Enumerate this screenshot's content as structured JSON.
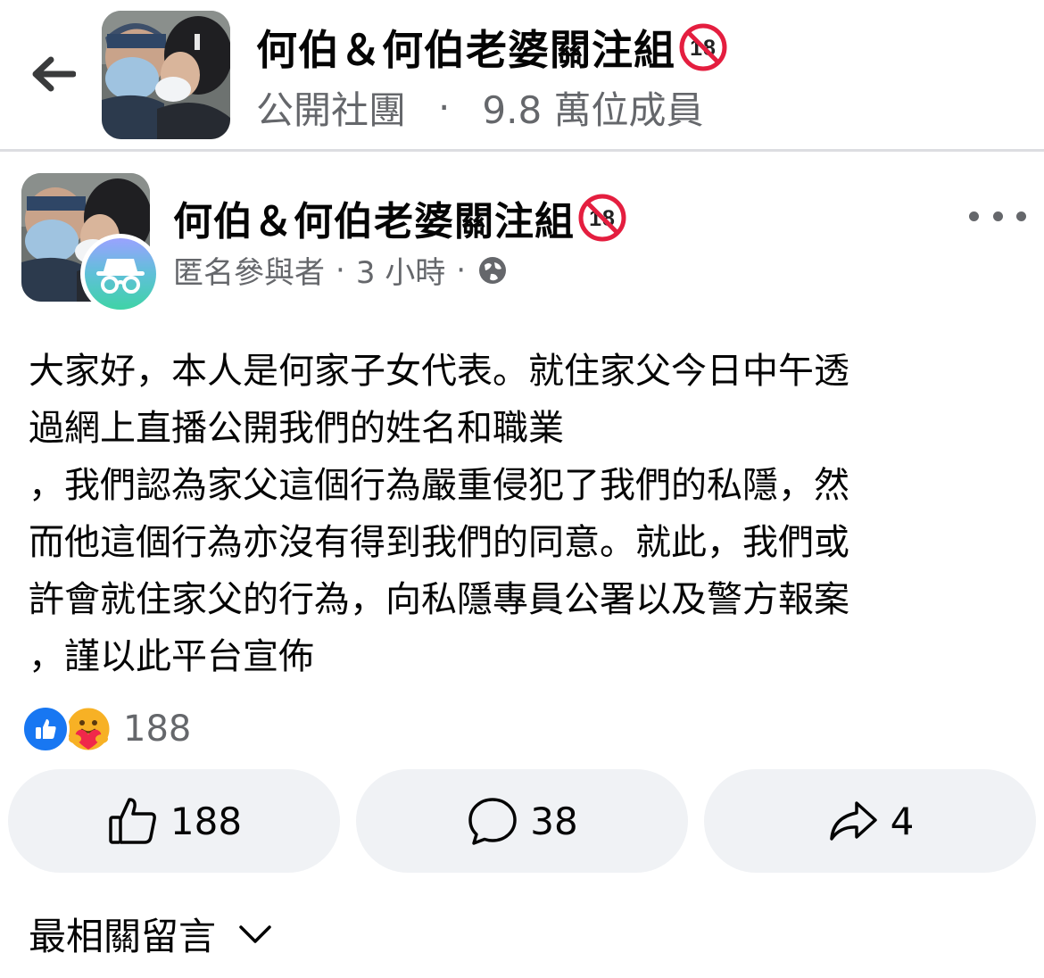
{
  "header": {
    "back_icon": "arrow-left-icon",
    "group_name": "何伯＆何伯老婆關注組",
    "privacy": "公開社團",
    "separator": "·",
    "members": "9.8 萬位成員"
  },
  "post": {
    "group_name": "何伯＆何伯老婆關注組",
    "author": "匿名參與者",
    "meta_sep": "·",
    "time": "3 小時",
    "audience_icon": "globe-icon",
    "body_lines": [
      "大家好，本人是何家子女代表。就住家父今日中午透",
      "過網上直播公開我們的姓名和職業",
      "，我們認為家父這個行為嚴重侵犯了我們的私隱，然",
      "而他這個行為亦沒有得到我們的同意。就此，我們或",
      "許會就住家父的行為，向私隱專員公署以及警方報案",
      "，謹以此平台宣佈"
    ],
    "reaction_count": "188"
  },
  "actions": {
    "like_count": "188",
    "comment_count": "38",
    "share_count": "4"
  },
  "comments": {
    "sort_label": "最相關留言"
  },
  "colors": {
    "accent": "#1877f2",
    "secondary_text": "#65676b",
    "button_bg": "#f0f2f5",
    "age_badge_red": "#e41e3f"
  }
}
